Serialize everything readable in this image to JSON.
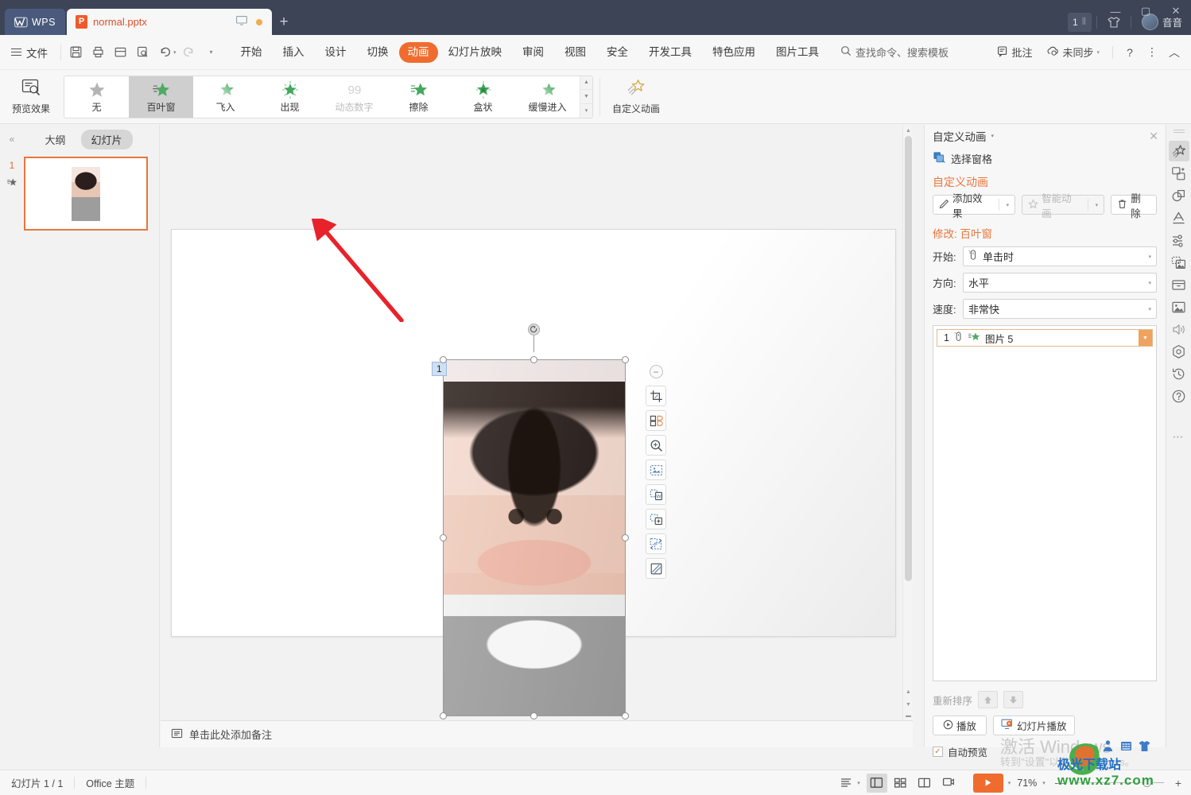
{
  "titlebar": {
    "app_name": "WPS",
    "tab_title": "normal.pptx",
    "newtab_label": "+",
    "count_badge": "1",
    "user_name": "音音",
    "minimize": "—",
    "maximize": "▢",
    "close": "✕"
  },
  "menubar": {
    "file_label": "文件",
    "quick_icons": [
      "save-icon",
      "print-icon",
      "save-as-icon",
      "print-preview-icon",
      "undo-icon",
      "redo-icon",
      "customize-icon"
    ],
    "items": [
      {
        "label": "开始",
        "active": false
      },
      {
        "label": "插入",
        "active": false
      },
      {
        "label": "设计",
        "active": false
      },
      {
        "label": "切换",
        "active": false
      },
      {
        "label": "动画",
        "active": true
      },
      {
        "label": "幻灯片放映",
        "active": false
      },
      {
        "label": "审阅",
        "active": false
      },
      {
        "label": "视图",
        "active": false
      },
      {
        "label": "安全",
        "active": false
      },
      {
        "label": "开发工具",
        "active": false
      },
      {
        "label": "特色应用",
        "active": false
      },
      {
        "label": "图片工具",
        "active": false
      }
    ],
    "search_label": "查找命令、搜索模板",
    "comment_label": "批注",
    "sync_label": "未同步",
    "help_label": "?",
    "more_label": "⋮",
    "collapse_label": "︿"
  },
  "ribbon": {
    "preview_label": "预览效果",
    "gallery": [
      {
        "label": "无",
        "state": "none"
      },
      {
        "label": "百叶窗",
        "state": "selected"
      },
      {
        "label": "飞入",
        "state": "normal"
      },
      {
        "label": "出现",
        "state": "normal"
      },
      {
        "label": "动态数字",
        "state": "disabled"
      },
      {
        "label": "擦除",
        "state": "normal"
      },
      {
        "label": "盒状",
        "state": "normal"
      },
      {
        "label": "缓慢进入",
        "state": "normal"
      }
    ],
    "custom_anim_label": "自定义动画"
  },
  "leftpanel": {
    "collapse_icon": "chevron-left-icon",
    "tabs": [
      {
        "label": "大纲",
        "active": false
      },
      {
        "label": "幻灯片",
        "active": true
      }
    ],
    "slides": [
      {
        "number": "1",
        "has_animation": true
      }
    ]
  },
  "editarea": {
    "notes_placeholder": "单击此处添加备注",
    "animation_tag": "1",
    "image_tools": [
      "crop-icon",
      "flip-compare-icon",
      "zoom-in-icon",
      "remove-background-icon",
      "extract-text-icon",
      "add-image-icon",
      "replace-image-icon",
      "image-effect-icon"
    ],
    "collapse_tools_icon": "minus-circle-icon",
    "rotate_icon": "rotate-handle-icon"
  },
  "rightpanel": {
    "header_title": "自定义动画",
    "close_icon": "close-icon",
    "select_pane_label": "选择窗格",
    "section_title": "自定义动画",
    "add_effect_label": "添加效果",
    "smart_anim_label": "智能动画",
    "delete_label": "删除",
    "modify_label": "修改:",
    "modify_effect": "百叶窗",
    "fields": [
      {
        "label": "开始:",
        "value": "单击时",
        "icon": "mouse-click-icon"
      },
      {
        "label": "方向:",
        "value": "水平",
        "icon": ""
      },
      {
        "label": "速度:",
        "value": "非常快",
        "icon": ""
      }
    ],
    "anim_items": [
      {
        "index": "1",
        "name": "图片 5",
        "trigger_icon": "mouse-click-icon",
        "effect_icon": "blinds-star-icon"
      }
    ],
    "reorder_label": "重新排序",
    "reorder_up": "up-arrow-icon",
    "reorder_down": "down-arrow-icon",
    "play_label": "播放",
    "slideshow_label": "幻灯片播放",
    "autopreview_label": "自动预览",
    "autopreview_checked": true
  },
  "rail": {
    "items": [
      {
        "name": "animation-panel-icon",
        "active": true
      },
      {
        "name": "transition-icon",
        "active": false
      },
      {
        "name": "shape-icon",
        "active": false
      },
      {
        "name": "text-art-icon",
        "active": false
      },
      {
        "name": "adjust-sliders-icon",
        "active": false
      },
      {
        "name": "image-collection-icon",
        "active": false
      },
      {
        "name": "box-icon",
        "active": false
      },
      {
        "name": "picture-icon",
        "active": false
      },
      {
        "name": "audio-icon",
        "active": false
      },
      {
        "name": "badge-icon",
        "active": false
      },
      {
        "name": "history-icon",
        "active": false
      },
      {
        "name": "help-circle-icon",
        "active": false
      }
    ],
    "more_label": "⋯"
  },
  "statusbar": {
    "slide_counter": "幻灯片 1 / 1",
    "theme_label": "Office 主题",
    "view_icons": [
      "outline-view-icon",
      "normal-view-icon",
      "slide-sorter-icon",
      "reading-view-icon",
      "presenter-view-icon"
    ],
    "play_icon": "play-icon",
    "zoom_value": "71%",
    "zoom_minus": "—",
    "zoom_plus": "+"
  },
  "watermarks": {
    "activate_line1": "激活 Windows",
    "activate_line2": "转到\"设置\"以激活 Windows。",
    "site_name": "极光下载站",
    "site_url": "www.xz7.com"
  },
  "colors": {
    "accent": "#ef6c2e",
    "titlebar_bg": "#3d4456",
    "panel_bg": "#f7f7f7",
    "selection_border": "#e8763c"
  }
}
